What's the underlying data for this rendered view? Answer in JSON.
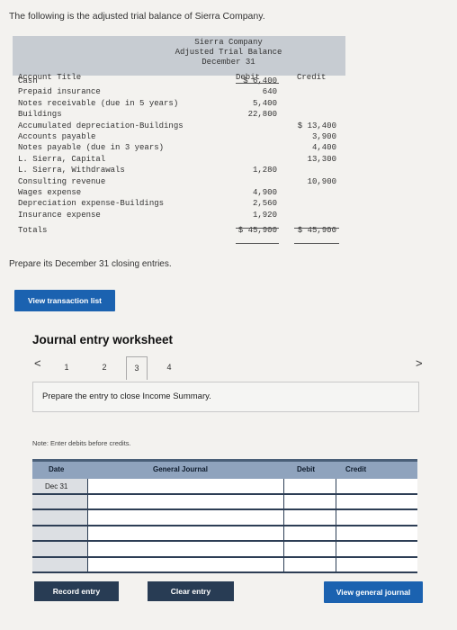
{
  "intro": "The following is the adjusted trial balance of Sierra Company.",
  "trial_balance": {
    "company": "Sierra Company",
    "title": "Adjusted Trial Balance",
    "date": "December 31",
    "col_account": "Account Title",
    "col_debit": "Debit",
    "col_credit": "Credit",
    "rows": [
      {
        "name": "Cash",
        "debit": "$ 6,400",
        "credit": ""
      },
      {
        "name": "Prepaid insurance",
        "debit": "640",
        "credit": ""
      },
      {
        "name": "Notes receivable (due in 5 years)",
        "debit": "5,400",
        "credit": ""
      },
      {
        "name": "Buildings",
        "debit": "22,800",
        "credit": ""
      },
      {
        "name": "Accumulated depreciation-Buildings",
        "debit": "",
        "credit": "$ 13,400"
      },
      {
        "name": "Accounts payable",
        "debit": "",
        "credit": "3,900"
      },
      {
        "name": "Notes payable (due in 3 years)",
        "debit": "",
        "credit": "4,400"
      },
      {
        "name": "L. Sierra, Capital",
        "debit": "",
        "credit": "13,300"
      },
      {
        "name": "L. Sierra, Withdrawals",
        "debit": "1,280",
        "credit": ""
      },
      {
        "name": "Consulting revenue",
        "debit": "",
        "credit": "10,900"
      },
      {
        "name": "Wages expense",
        "debit": "4,900",
        "credit": ""
      },
      {
        "name": "Depreciation expense-Buildings",
        "debit": "2,560",
        "credit": ""
      },
      {
        "name": "Insurance expense",
        "debit": "1,920",
        "credit": ""
      },
      {
        "name": "Totals",
        "debit": "$ 45,900",
        "credit": "$ 45,900"
      }
    ]
  },
  "prepare_text": "Prepare its December 31 closing entries.",
  "view_transaction_btn": "View transaction list",
  "worksheet_title": "Journal entry worksheet",
  "pager": {
    "prev": "<",
    "next": ">",
    "pages": [
      "1",
      "2",
      "3",
      "4"
    ],
    "active": "3"
  },
  "instruction": "Prepare the entry to close Income Summary.",
  "note": "Note: Enter debits before credits.",
  "journal": {
    "col_date": "Date",
    "col_general": "General Journal",
    "col_debit": "Debit",
    "col_credit": "Credit",
    "first_date": "Dec 31"
  },
  "buttons": {
    "record": "Record entry",
    "clear": "Clear entry",
    "view_general": "View general journal"
  }
}
